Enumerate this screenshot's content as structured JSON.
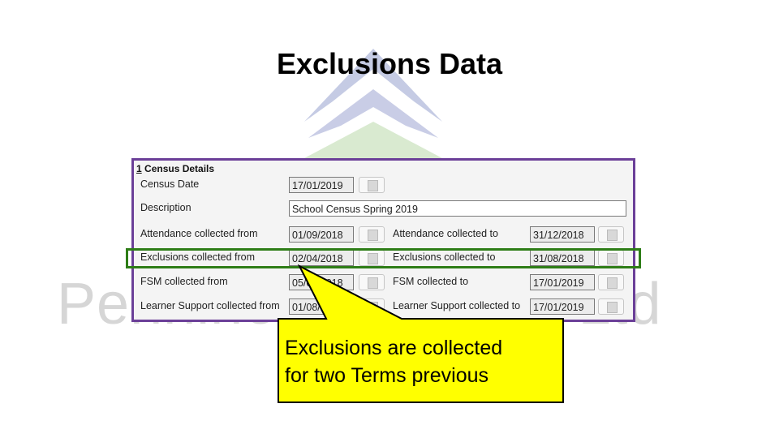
{
  "title": "Exclusions Data",
  "watermark": {
    "logo_text": "Pennine Education Ltd"
  },
  "panel": {
    "header_num": "1",
    "header": "Census Details",
    "census_date": {
      "label": "Census Date",
      "value": "17/01/2019"
    },
    "description": {
      "label": "Description",
      "value": "School Census Spring 2019"
    },
    "rows": [
      {
        "from_label": "Attendance collected from",
        "from": "01/09/2018",
        "to_label": "Attendance collected to",
        "to": "31/12/2018"
      },
      {
        "from_label": "Exclusions collected from",
        "from": "02/04/2018",
        "to_label": "Exclusions collected to",
        "to": "31/08/2018"
      },
      {
        "from_label": "FSM collected from",
        "from": "05/04/2018",
        "to_label": "FSM collected to",
        "to": "17/01/2019"
      },
      {
        "from_label": "Learner Support collected from",
        "from": "01/08/2018",
        "to_label": "Learner Support collected to",
        "to": "17/01/2019"
      }
    ]
  },
  "callout": {
    "line1": "Exclusions are collected",
    "line2": "for two Terms previous",
    "color": "#ffff00"
  },
  "colors": {
    "panel_border": "#6b3f98",
    "highlight": "#2e7d17"
  }
}
